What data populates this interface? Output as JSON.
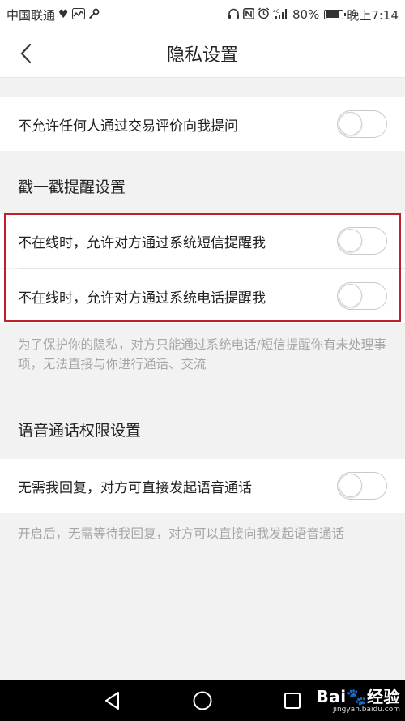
{
  "status_bar": {
    "carrier": "中国联通",
    "battery_percent": "80%",
    "battery_level": 0.8,
    "time": "晚上7:14",
    "icons_left": [
      "heart-rate-icon",
      "activity-icon",
      "key-icon"
    ],
    "icons_right": [
      "headset-icon",
      "nfc-icon",
      "alarm-icon",
      "signal-4g-icon",
      "battery-icon"
    ]
  },
  "nav": {
    "title": "隐私设置",
    "back_icon": "chevron-left-icon"
  },
  "rows": {
    "no_question": {
      "label": "不允许任何人通过交易评价向我提问",
      "on": false
    },
    "sms_remind": {
      "label": "不在线时，允许对方通过系统短信提醒我",
      "on": false
    },
    "phone_remind": {
      "label": "不在线时，允许对方通过系统电话提醒我",
      "on": false
    },
    "voice_call": {
      "label": "无需我回复，对方可直接发起语音通话",
      "on": false
    }
  },
  "sections": {
    "poke": "戳一戳提醒设置",
    "voice": "语音通话权限设置"
  },
  "notes": {
    "poke_note": "为了保护你的隐私，对方只能通过系统电话/短信提醒你有未处理事项，无法直接与你进行通话、交流",
    "voice_note": "开启后，无需等待我回复，对方可以直接向我发起语音通话"
  },
  "bottom_nav": {
    "buttons": [
      "back-triangle-icon",
      "home-circle-icon",
      "recent-square-icon"
    ]
  },
  "watermark": {
    "main": "Bai🐾经验",
    "sub": "jingyan.baidu.com"
  },
  "colors": {
    "highlight": "#c0202a",
    "background": "#f2f2f2",
    "note_text": "#a6a6a6"
  }
}
